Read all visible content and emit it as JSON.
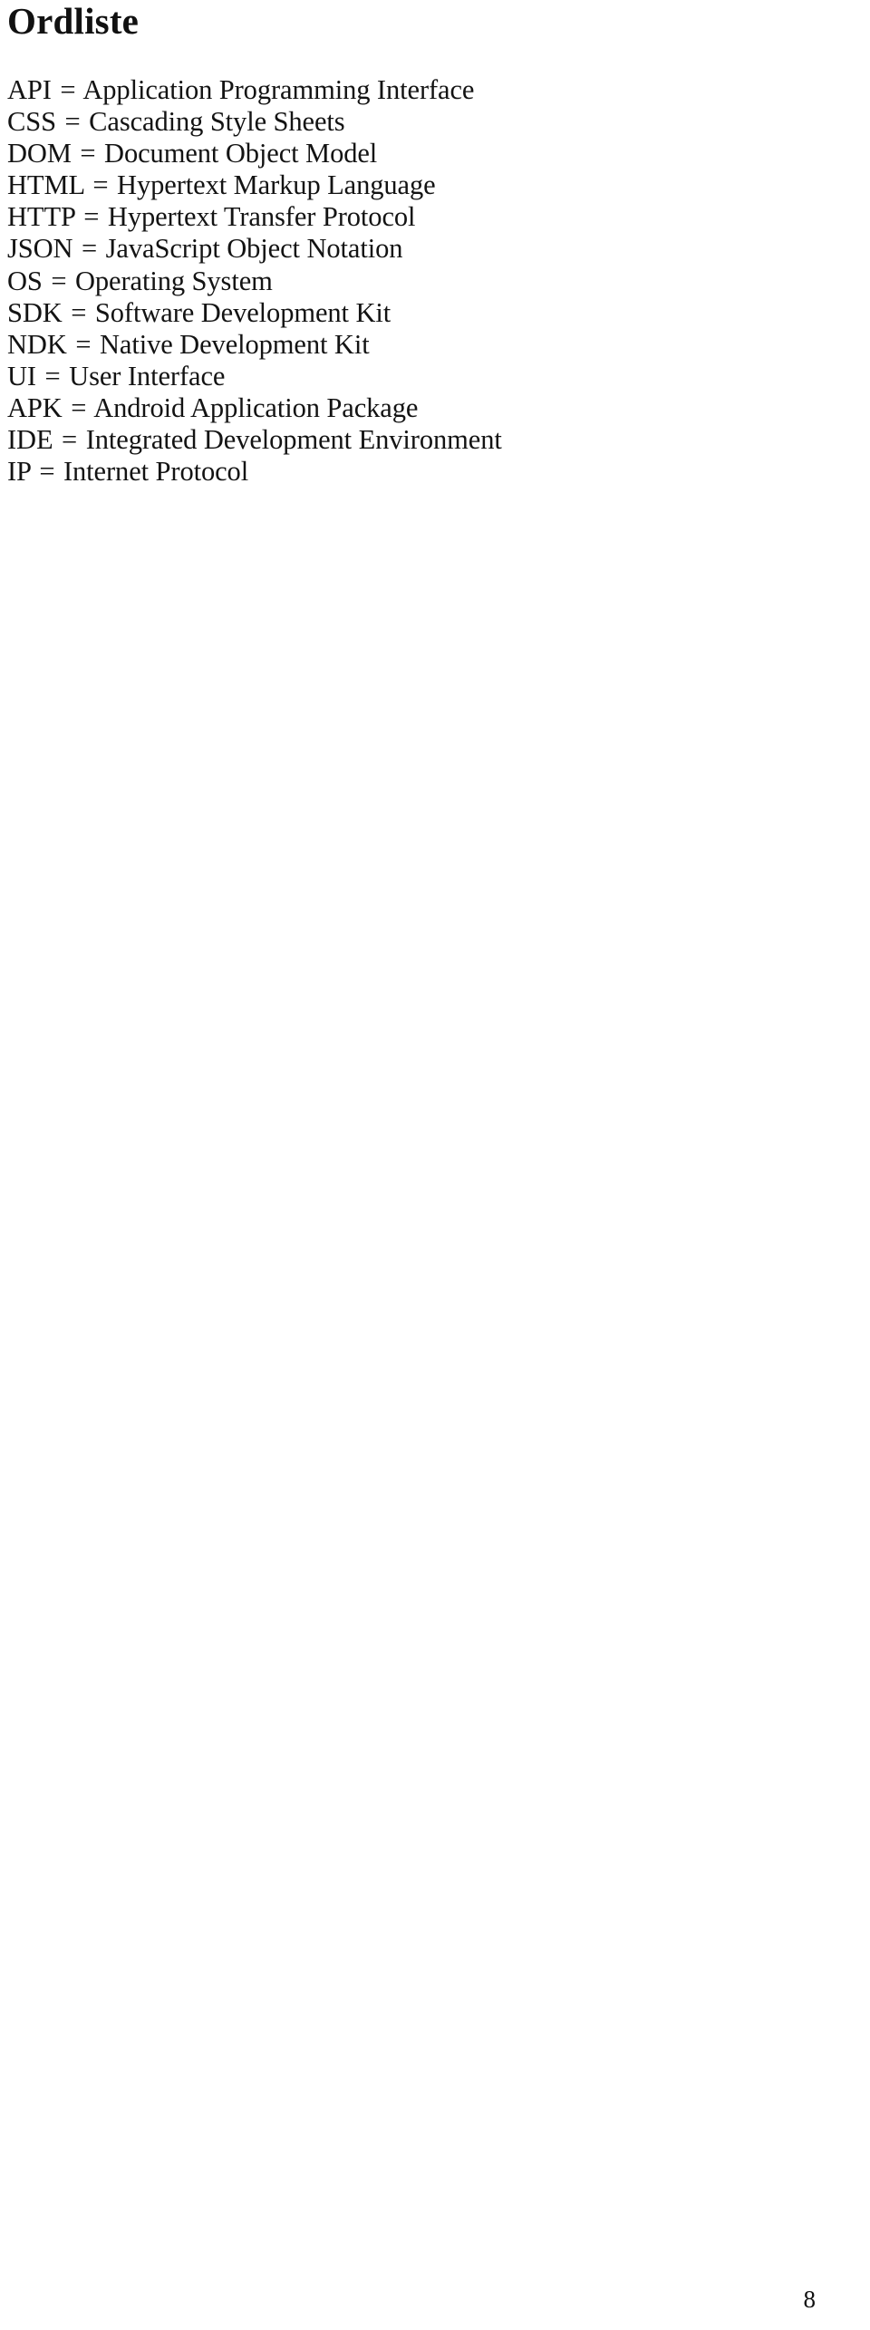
{
  "document": {
    "title": "Ordliste",
    "page_number": "8",
    "separator": "=",
    "glossary": [
      {
        "term": "API",
        "definition": "Application Programming Interface"
      },
      {
        "term": "CSS",
        "definition": "Cascading Style Sheets"
      },
      {
        "term": "DOM",
        "definition": "Document Object Model"
      },
      {
        "term": "HTML",
        "definition": "Hypertext Markup Language"
      },
      {
        "term": "HTTP",
        "definition": "Hypertext Transfer Protocol"
      },
      {
        "term": "JSON",
        "definition": "JavaScript Object Notation"
      },
      {
        "term": "OS",
        "definition": "Operating System"
      },
      {
        "term": "SDK",
        "definition": "Software Development Kit"
      },
      {
        "term": "NDK",
        "definition": "Native Development Kit"
      },
      {
        "term": "UI",
        "definition": "User Interface"
      },
      {
        "term": "APK",
        "definition": "Android Application Package"
      },
      {
        "term": "IDE",
        "definition": "Integrated Development Environment"
      },
      {
        "term": "IP",
        "definition": "Internet Protocol"
      }
    ]
  },
  "colors": {
    "page_background": "#ffffff",
    "text": "#111111"
  }
}
